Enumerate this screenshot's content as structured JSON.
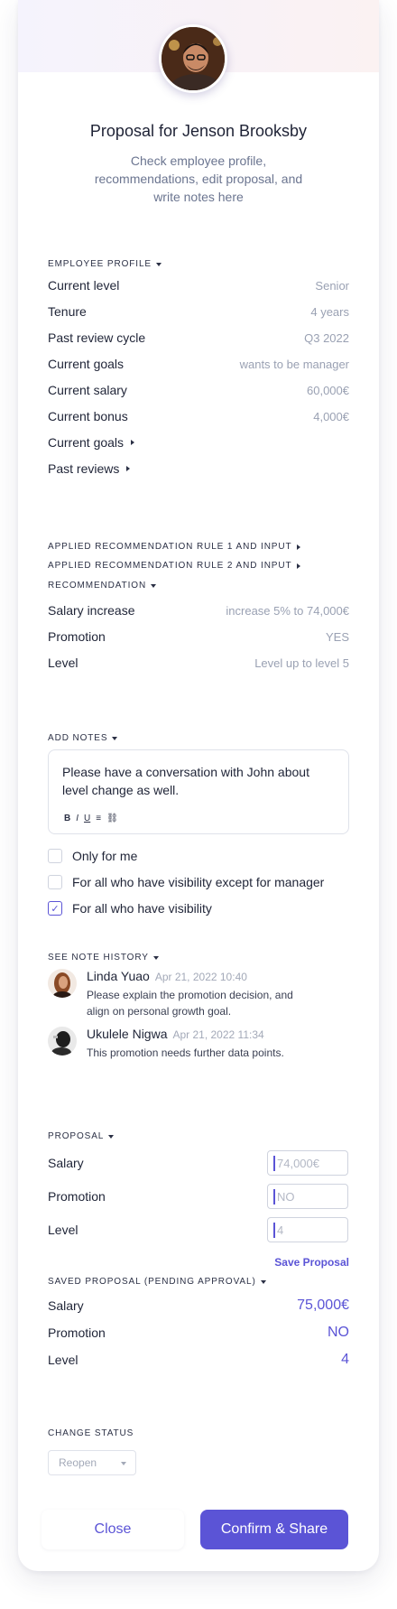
{
  "header": {
    "title": "Proposal for Jenson Brooksby",
    "subtitle": "Check employee profile, recommendations, edit proposal, and write notes here"
  },
  "employee_profile": {
    "section": "EMPLOYEE PROFILE",
    "rows": [
      {
        "label": "Current level",
        "value": "Senior"
      },
      {
        "label": "Tenure",
        "value": "4 years"
      },
      {
        "label": "Past review cycle",
        "value": "Q3 2022"
      },
      {
        "label": "Current goals",
        "value": "wants to be manager"
      },
      {
        "label": "Current salary",
        "value": "60,000€"
      },
      {
        "label": "Current bonus",
        "value": "4,000€"
      }
    ],
    "expandables": [
      "Current goals",
      "Past reviews"
    ]
  },
  "recommendation": {
    "rule1": "APPLIED RECOMMENDATION RULE 1 AND INPUT",
    "rule2": "APPLIED RECOMMENDATION RULE 2 AND INPUT",
    "section": "RECOMMENDATION",
    "rows": [
      {
        "label": "Salary increase",
        "value": "increase 5% to 74,000€"
      },
      {
        "label": "Promotion",
        "value": "YES"
      },
      {
        "label": "Level",
        "value": "Level up to level 5"
      }
    ]
  },
  "notes": {
    "section": "ADD NOTES",
    "text": "Please have a conversation with John about level change as well.",
    "tools": [
      "B",
      "I",
      "U",
      "≡",
      "⛓"
    ],
    "visibility": [
      {
        "label": "Only for me",
        "checked": false
      },
      {
        "label": "For all who have visibility except for manager",
        "checked": false
      },
      {
        "label": "For all who have visibility",
        "checked": true
      }
    ]
  },
  "history": {
    "section": "SEE NOTE HISTORY",
    "items": [
      {
        "name": "Linda Yuao",
        "date": "Apr 21, 2022 10:40",
        "text": "Please explain the promotion decision, and align on personal growth goal."
      },
      {
        "name": "Ukulele Nigwa",
        "date": "Apr 21, 2022 11:34",
        "text": "This promotion needs further data points."
      }
    ]
  },
  "proposal": {
    "section": "PROPOSAL",
    "rows": [
      {
        "label": "Salary",
        "placeholder": "74,000€"
      },
      {
        "label": "Promotion",
        "placeholder": "NO"
      },
      {
        "label": "Level",
        "placeholder": "4"
      }
    ],
    "save_label": "Save Proposal"
  },
  "saved_proposal": {
    "section": "SAVED PROPOSAL (PENDING APPROVAL)",
    "rows": [
      {
        "label": "Salary",
        "value": "75,000€"
      },
      {
        "label": "Promotion",
        "value": "NO"
      },
      {
        "label": "Level",
        "value": "4"
      }
    ]
  },
  "status": {
    "section": "CHANGE STATUS",
    "selected": "Reopen"
  },
  "footer": {
    "close_label": "Close",
    "confirm_label": "Confirm & Share"
  },
  "colors": {
    "accent": "#5b54d6"
  }
}
